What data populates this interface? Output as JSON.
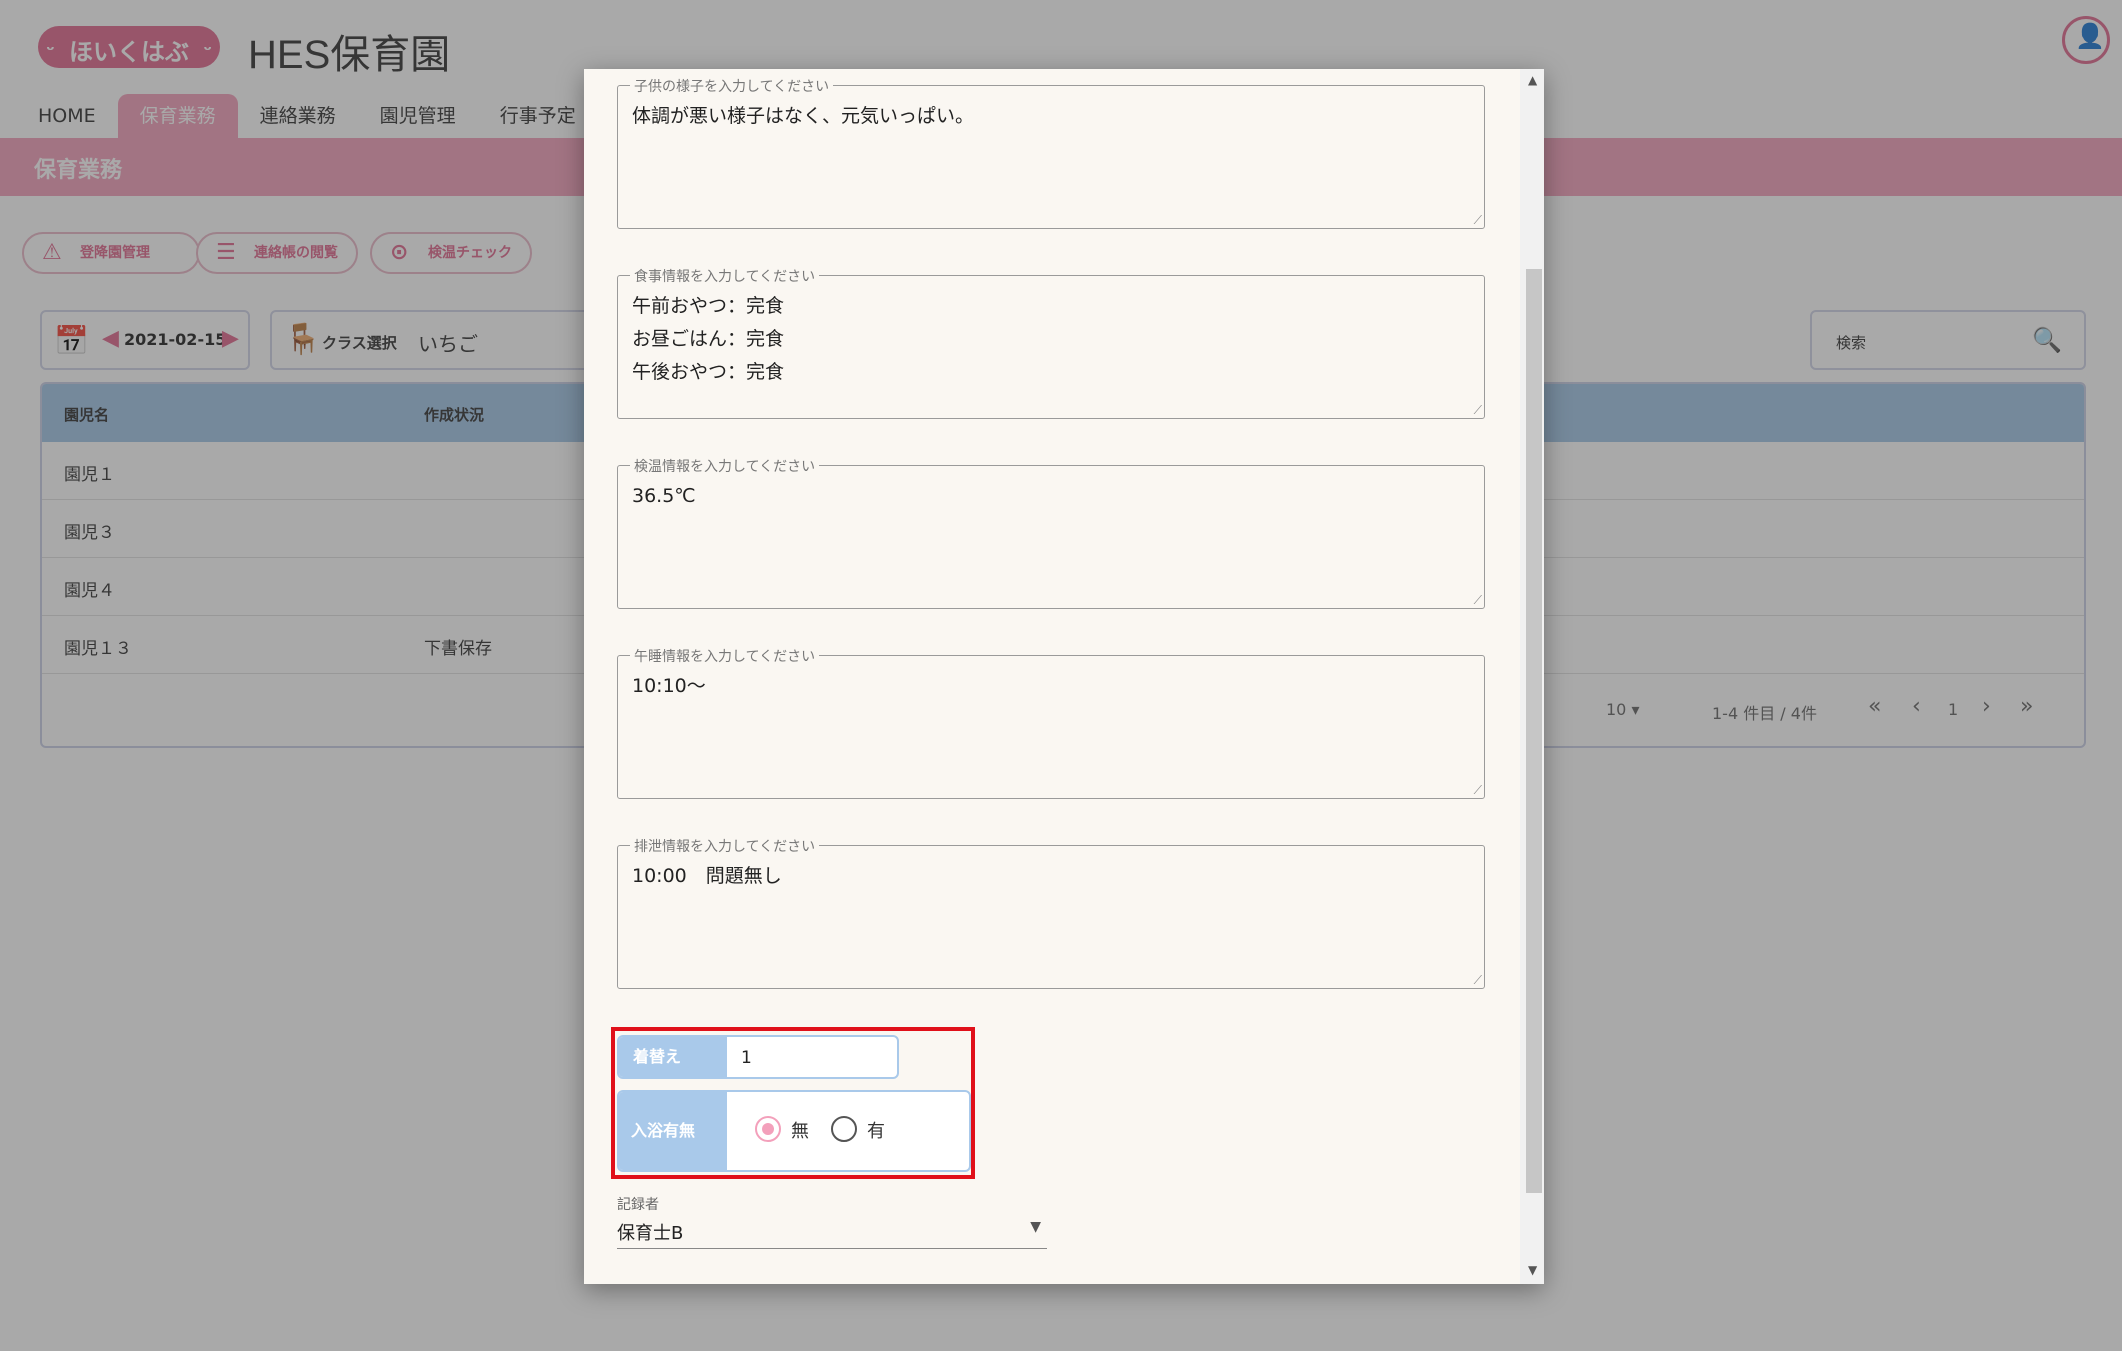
{
  "header": {
    "logo_text": "ほいくはぶ",
    "logo_smile_left": "ᵕ",
    "logo_smile_right": "ᵕ",
    "site_title": "HES保育園",
    "avatar_icon": "👤"
  },
  "nav": {
    "items": [
      "HOME",
      "保育業務",
      "連絡業務",
      "園児管理",
      "行事予定"
    ],
    "active": "保育業務"
  },
  "section_title": "保育業務",
  "toolbar": {
    "buttons": [
      {
        "label": "登降園管理",
        "icon": "⚠"
      },
      {
        "label": "連絡帳の閲覧",
        "icon": "☰"
      },
      {
        "label": "検温チェック",
        "icon": "⊙"
      }
    ]
  },
  "filters": {
    "calendar_icon": "📅",
    "prev_icon": "◀",
    "next_icon": "▶",
    "date": "2021-02-15",
    "chair_icon": "🪑",
    "class_label": "クラス選択",
    "class_value": "いちご",
    "search_label": "検索",
    "search_icon": "🔍"
  },
  "table": {
    "columns": [
      "園児名",
      "作成状況"
    ],
    "rows": [
      {
        "name": "園児１",
        "status": ""
      },
      {
        "name": "園児３",
        "status": ""
      },
      {
        "name": "園児４",
        "status": ""
      },
      {
        "name": "園児１３",
        "status": "下書保存"
      }
    ],
    "pager": {
      "per_page": "10 ▾",
      "range": "1-4 件目 / 4件",
      "first": "«",
      "prev": "‹",
      "page": "1",
      "next": "›",
      "last": "»"
    }
  },
  "dialog": {
    "scroll_up": "▲",
    "scroll_down": "▼",
    "resize_grip": "⟋",
    "fields": [
      {
        "legend": "子供の様子を入力してください",
        "value": "体調が悪い様子はなく、元気いっぱい。"
      },
      {
        "legend": "食事情報を入力してください",
        "value": "午前おやつ：完食\nお昼ごはん：完食\n午後おやつ：完食"
      },
      {
        "legend": "検温情報を入力してください",
        "value": "36.5℃"
      },
      {
        "legend": "午睡情報を入力してください",
        "value": "10:10～"
      },
      {
        "legend": "排泄情報を入力してください",
        "value": "10:00　問題無し"
      }
    ],
    "changing": {
      "label": "着替え",
      "value": "1"
    },
    "bath": {
      "label": "入浴有無",
      "options": [
        "無",
        "有"
      ],
      "selected": "無"
    },
    "recorder": {
      "label": "記録者",
      "value": "保育士B",
      "caret": "▼"
    }
  },
  "colors": {
    "brand_pink": "#f3a0bb",
    "logo_pink": "#e06a8f",
    "label_blue": "#a9c9ea",
    "highlight_red": "#e0101a"
  }
}
